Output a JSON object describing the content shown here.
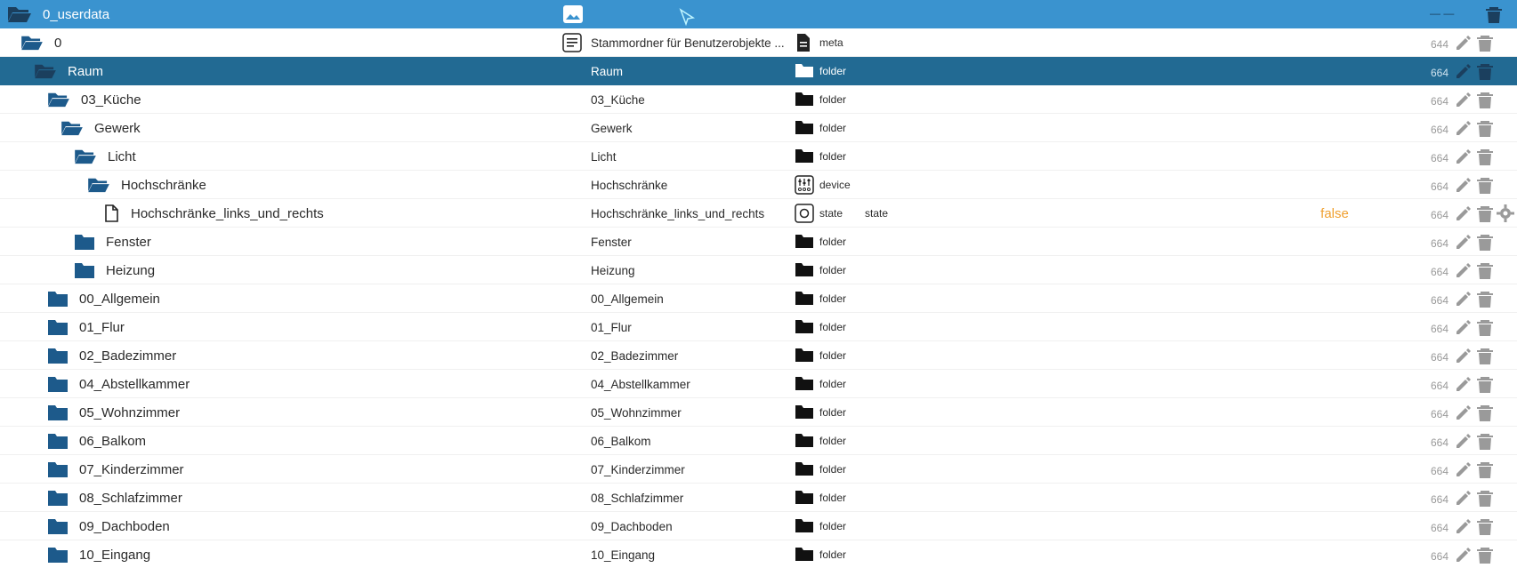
{
  "header": {
    "title": "0_userdata",
    "top_right_dash": "— —"
  },
  "rows": [
    {
      "id": "0",
      "level": 1,
      "open": true,
      "name": "Stammordner für Benutzerobjekte ...",
      "type": "meta",
      "type_icon": "document-icon",
      "role": "",
      "value": "",
      "acl": "644"
    },
    {
      "id": "Raum",
      "level": 2,
      "open": true,
      "name": "Raum",
      "type": "folder",
      "type_icon": "folder-icon",
      "role": "",
      "value": "",
      "acl": "664",
      "selected": true
    },
    {
      "id": "03_Küche",
      "level": 3,
      "open": true,
      "name": "03_Küche",
      "type": "folder",
      "type_icon": "folder-icon",
      "role": "",
      "value": "",
      "acl": "664"
    },
    {
      "id": "Gewerk",
      "level": 4,
      "open": true,
      "name": "Gewerk",
      "type": "folder",
      "type_icon": "folder-icon",
      "role": "",
      "value": "",
      "acl": "664"
    },
    {
      "id": "Licht",
      "level": 5,
      "open": true,
      "name": "Licht",
      "type": "folder",
      "type_icon": "folder-icon",
      "role": "",
      "value": "",
      "acl": "664"
    },
    {
      "id": "Hochschränke",
      "level": 6,
      "open": true,
      "name": "Hochschränke",
      "type": "device",
      "type_icon": "device-icon",
      "role": "",
      "value": "",
      "acl": "664"
    },
    {
      "id": "Hochschränke_links_und_rechts",
      "level": 7,
      "file": true,
      "name": "Hochschränke_links_und_rechts",
      "type": "state",
      "type_icon": "state-icon",
      "role": "state",
      "value": "false",
      "acl": "664",
      "settings": true
    },
    {
      "id": "Fenster",
      "level": 5,
      "open": false,
      "name": "Fenster",
      "type": "folder",
      "type_icon": "folder-icon",
      "role": "",
      "value": "",
      "acl": "664"
    },
    {
      "id": "Heizung",
      "level": 5,
      "open": false,
      "name": "Heizung",
      "type": "folder",
      "type_icon": "folder-icon",
      "role": "",
      "value": "",
      "acl": "664"
    },
    {
      "id": "00_Allgemein",
      "level": 3,
      "open": false,
      "name": "00_Allgemein",
      "type": "folder",
      "type_icon": "folder-icon",
      "role": "",
      "value": "",
      "acl": "664"
    },
    {
      "id": "01_Flur",
      "level": 3,
      "open": false,
      "name": "01_Flur",
      "type": "folder",
      "type_icon": "folder-icon",
      "role": "",
      "value": "",
      "acl": "664"
    },
    {
      "id": "02_Badezimmer",
      "level": 3,
      "open": false,
      "name": "02_Badezimmer",
      "type": "folder",
      "type_icon": "folder-icon",
      "role": "",
      "value": "",
      "acl": "664"
    },
    {
      "id": "04_Abstellkammer",
      "level": 3,
      "open": false,
      "name": "04_Abstellkammer",
      "type": "folder",
      "type_icon": "folder-icon",
      "role": "",
      "value": "",
      "acl": "664"
    },
    {
      "id": "05_Wohnzimmer",
      "level": 3,
      "open": false,
      "name": "05_Wohnzimmer",
      "type": "folder",
      "type_icon": "folder-icon",
      "role": "",
      "value": "",
      "acl": "664"
    },
    {
      "id": "06_Balkom",
      "level": 3,
      "open": false,
      "name": "06_Balkom",
      "type": "folder",
      "type_icon": "folder-icon",
      "role": "",
      "value": "",
      "acl": "664"
    },
    {
      "id": "07_Kinderzimmer",
      "level": 3,
      "open": false,
      "name": "07_Kinderzimmer",
      "type": "folder",
      "type_icon": "folder-icon",
      "role": "",
      "value": "",
      "acl": "664"
    },
    {
      "id": "08_Schlafzimmer",
      "level": 3,
      "open": false,
      "name": "08_Schlafzimmer",
      "type": "folder",
      "type_icon": "folder-icon",
      "role": "",
      "value": "",
      "acl": "664"
    },
    {
      "id": "09_Dachboden",
      "level": 3,
      "open": false,
      "name": "09_Dachboden",
      "type": "folder",
      "type_icon": "folder-icon",
      "role": "",
      "value": "",
      "acl": "664"
    },
    {
      "id": "10_Eingang",
      "level": 3,
      "open": false,
      "name": "10_Eingang",
      "type": "folder",
      "type_icon": "folder-icon",
      "role": "",
      "value": "",
      "acl": "664"
    }
  ],
  "colors": {
    "header_bg": "#3a93cf",
    "selected_bg": "#226a93",
    "folder_icon": "#1d5a8b",
    "value_text": "#f0a030"
  }
}
